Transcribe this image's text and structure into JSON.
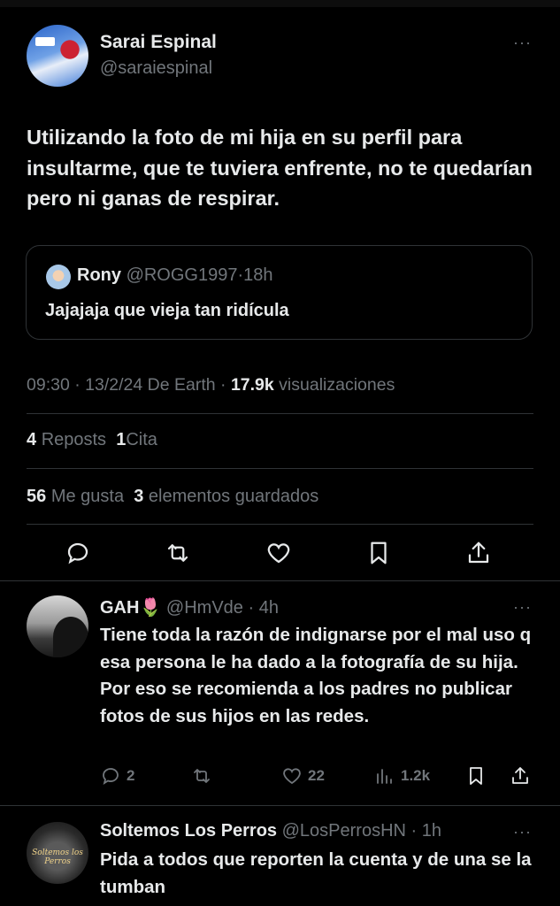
{
  "main_tweet": {
    "author_name": "Sarai Espinal",
    "author_handle": "@saraiespinal",
    "more_label": "···",
    "text": "Utilizando la foto de mi hija en su perfil para insultarme, que te tuviera enfrente, no te quedarían pero ni ganas de respirar.",
    "quote": {
      "author_name": "Rony",
      "author_handle": "@ROGG1997",
      "separator": "·",
      "time": "18h",
      "text": "Jajajaja que vieja tan ridícula"
    },
    "meta": {
      "time": "09:30",
      "date": "13/2/24",
      "source": "De Earth",
      "views_count": "17.9k",
      "views_label": "visualizaciones"
    },
    "stats": {
      "reposts_count": "4",
      "reposts_label": "Reposts",
      "quotes_count": "1",
      "quotes_label": "Cita",
      "likes_count": "56",
      "likes_label": "Me gusta",
      "bookmarks_count": "3",
      "bookmarks_label": "elementos guardados"
    }
  },
  "replies": [
    {
      "author_name": "GAH",
      "emoji": "🌷",
      "author_handle": "@HmVde",
      "time": "4h",
      "more_label": "···",
      "text": "Tiene toda la razón de indignarse por el mal uso q esa persona le ha dado a la fotografía de su hija. Por eso se recomienda a los padres no publicar fotos de sus hijos en las redes.",
      "replies_count": "2",
      "reposts_count": "",
      "likes_count": "22",
      "views_count": "1.2k"
    },
    {
      "author_name": "Soltemos Los Perros",
      "author_handle": "@LosPerrosHN",
      "time": "1h",
      "more_label": "···",
      "avatar_text": "Soltemos los Perros",
      "text": "Pida a todos que reporten la cuenta y de una se la tumban"
    }
  ],
  "colors": {
    "background": "#000000",
    "text": "#e7e9ea",
    "muted": "#71767b",
    "divider": "#2f3336"
  }
}
